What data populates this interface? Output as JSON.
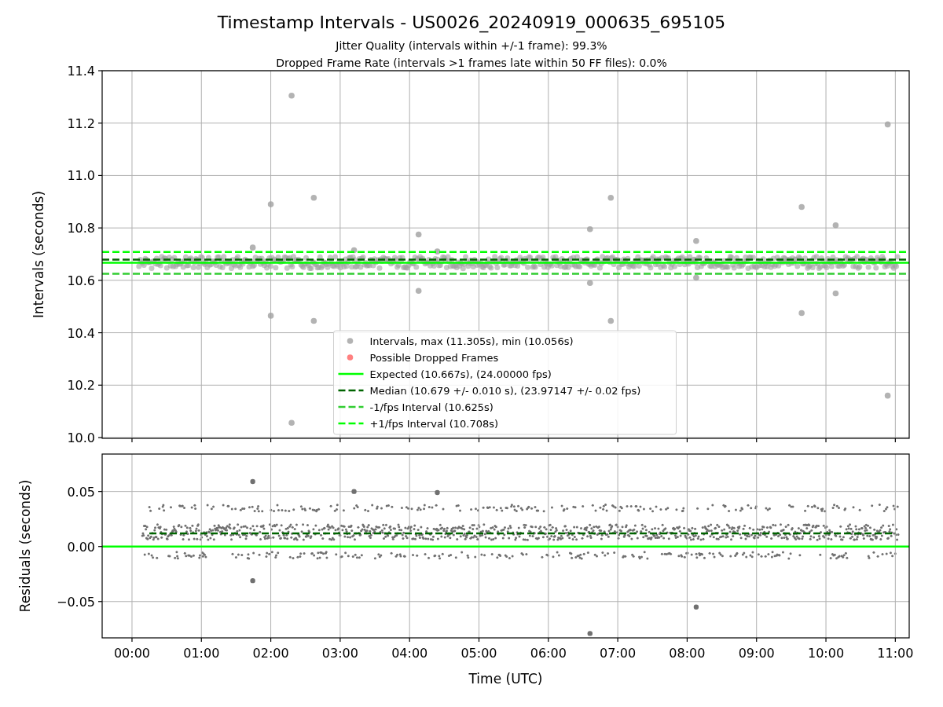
{
  "figure": {
    "title": "Timestamp Intervals - US0026_20240919_000635_695105",
    "subtitles": [
      "Jitter Quality (intervals within +/-1 frame): 99.3%",
      "Dropped Frame Rate (intervals >1 frames late within 50 FF files): 0.0%"
    ]
  },
  "charts": [
    {
      "chart_data": {
        "type": "scatter",
        "legend": "lower center",
        "ylabel": "Intervals (seconds)",
        "xlim": [
          -0.43,
          11.2
        ],
        "ylim": [
          9.997,
          11.4
        ],
        "grid": true,
        "yticks": [
          {
            "value": 10.0,
            "label": "10.0"
          },
          {
            "value": 10.2,
            "label": "10.2"
          },
          {
            "value": 10.4,
            "label": "10.4"
          },
          {
            "value": 10.6,
            "label": "10.6"
          },
          {
            "value": 10.8,
            "label": "10.8"
          },
          {
            "value": 11.0,
            "label": "11.0"
          },
          {
            "value": 11.2,
            "label": "11.2"
          },
          {
            "value": 11.4,
            "label": "11.4"
          }
        ],
        "series": [
          {
            "name": "Intervals, max (11.305s), min (10.056s)",
            "color": "#a0a0a0",
            "x": [
              2.3,
              2.0,
              2.62,
              1.74,
              2.0,
              2.62,
              2.3,
              3.2,
              4.13,
              4.13,
              4.4,
              6.6,
              6.6,
              6.9,
              6.9,
              8.13,
              8.13,
              9.65,
              9.65,
              10.14,
              10.14,
              10.89,
              10.89
            ],
            "values": [
              11.305,
              10.89,
              10.915,
              10.725,
              10.465,
              10.445,
              10.056,
              10.715,
              10.775,
              10.56,
              10.71,
              10.795,
              10.59,
              10.915,
              10.445,
              10.75,
              10.61,
              10.88,
              10.475,
              10.81,
              10.55,
              11.195,
              10.16
            ]
          },
          {
            "name": "Possible Dropped Frames",
            "color": "#ff6060"
          }
        ],
        "ref_lines": [
          {
            "axis": "y",
            "label": "Expected (10.667s), (24.00000 fps)",
            "color": "#00ff00",
            "value": 10.667
          },
          {
            "axis": "y",
            "label": "Median (10.679 +/- 0.010 s), (23.97147 +/- 0.02 fps)",
            "color": "#006400",
            "value": 10.679
          },
          {
            "axis": "y",
            "label": "-1/fps Interval (10.625s)",
            "color": "#32cd32",
            "value": 10.625
          },
          {
            "axis": "y",
            "label": "+1/fps Interval (10.708s)",
            "color": "#00ff00",
            "value": 10.708
          }
        ]
      }
    },
    {
      "chart_data": {
        "type": "scatter",
        "grid": true,
        "xlabel": "Time (UTC)",
        "ylabel": "Residuals (seconds)",
        "xlim": [
          -0.43,
          11.2
        ],
        "ylim": [
          -0.083,
          0.084
        ],
        "xticks": [
          {
            "value": 0,
            "label": "00:00"
          },
          {
            "value": 1,
            "label": "01:00"
          },
          {
            "value": 2,
            "label": "02:00"
          },
          {
            "value": 3,
            "label": "03:00"
          },
          {
            "value": 4,
            "label": "04:00"
          },
          {
            "value": 5,
            "label": "05:00"
          },
          {
            "value": 6,
            "label": "06:00"
          },
          {
            "value": 7,
            "label": "07:00"
          },
          {
            "value": 8,
            "label": "08:00"
          },
          {
            "value": 9,
            "label": "09:00"
          },
          {
            "value": 10,
            "label": "10:00"
          },
          {
            "value": 11,
            "label": "11:00"
          }
        ],
        "yticks": [
          {
            "value": -0.05,
            "label": "−0.05"
          },
          {
            "value": 0,
            "label": "0.00"
          },
          {
            "value": 0.05,
            "label": "0.05"
          }
        ],
        "series": [
          {
            "color": "#707070",
            "x": [
              1.74,
              3.2,
              4.4,
              8.13,
              6.6,
              1.74
            ],
            "values": [
              0.059,
              0.05,
              0.049,
              -0.055,
              -0.079,
              -0.031
            ]
          }
        ],
        "ref_lines": [
          {
            "axis": "y",
            "color": "#00ff00",
            "value": 0
          },
          {
            "axis": "y",
            "color": "#006400",
            "value": 0.012
          }
        ]
      }
    }
  ]
}
